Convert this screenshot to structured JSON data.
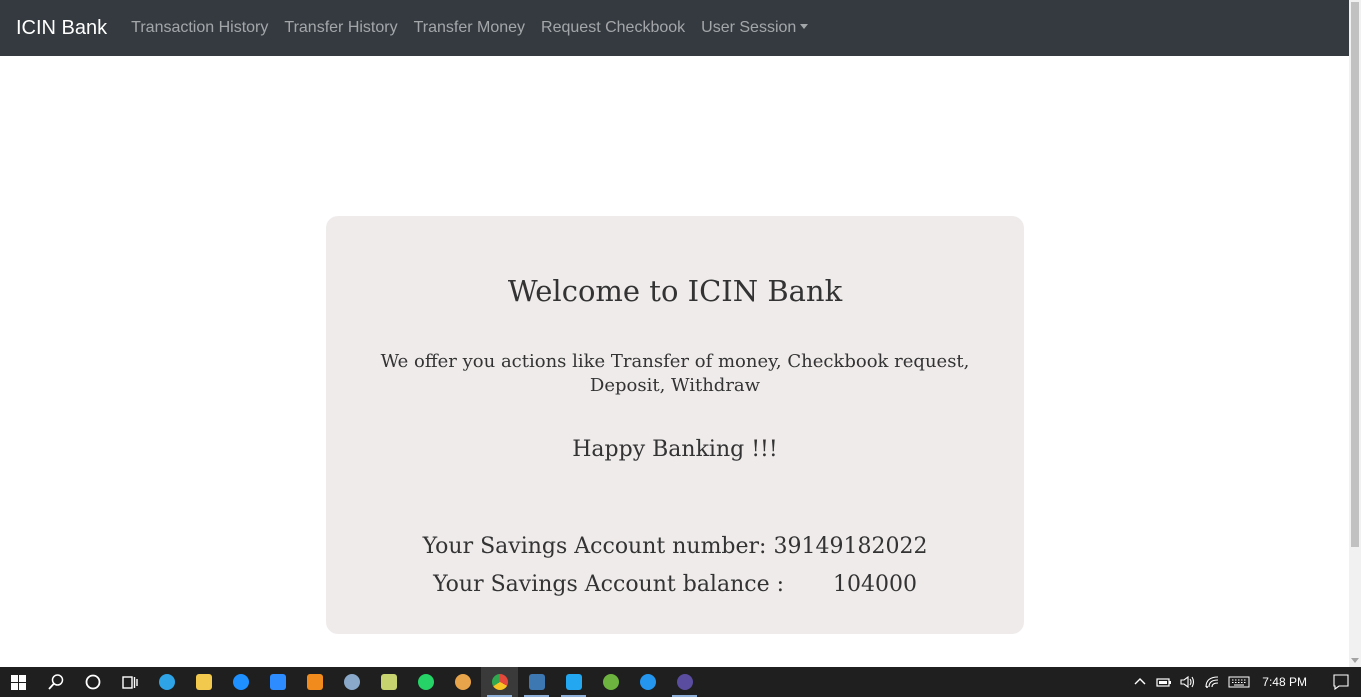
{
  "navbar": {
    "brand": "ICIN Bank",
    "links": [
      "Transaction History",
      "Transfer History",
      "Transfer Money",
      "Request Checkbook"
    ],
    "dropdown_label": "User Session"
  },
  "card": {
    "title": "Welcome to ICIN Bank",
    "offer_text": "We offer you actions like Transfer of money, Checkbook request, Deposit, Withdraw",
    "greeting": "Happy Banking !!!",
    "account_number_label": "Your Savings Account number:",
    "account_number": "39149182022",
    "balance_label": "Your Savings Account balance :",
    "balance": "104000"
  },
  "taskbar": {
    "apps": [
      {
        "name": "edge",
        "color": "#2ea3e5"
      },
      {
        "name": "file-explorer",
        "color": "#f2c94c"
      },
      {
        "name": "internet-explorer",
        "color": "#1e90ff"
      },
      {
        "name": "zoom",
        "color": "#2d8cff"
      },
      {
        "name": "sublime-text",
        "color": "#f28b1e"
      },
      {
        "name": "steam",
        "color": "#8aa8c9"
      },
      {
        "name": "notepad",
        "color": "#c7d36f"
      },
      {
        "name": "whatsapp",
        "color": "#25d366"
      },
      {
        "name": "app-stripes",
        "color": "#e8a44a"
      },
      {
        "name": "chrome",
        "color": "#e4483b"
      },
      {
        "name": "mysql-workbench",
        "color": "#3e78b2"
      },
      {
        "name": "vscode",
        "color": "#22a7f0"
      },
      {
        "name": "spring-tool-suite",
        "color": "#6db33f"
      },
      {
        "name": "docker",
        "color": "#2496ed"
      },
      {
        "name": "eclipse",
        "color": "#5a4c9e"
      }
    ],
    "clock": "7:48 PM"
  }
}
